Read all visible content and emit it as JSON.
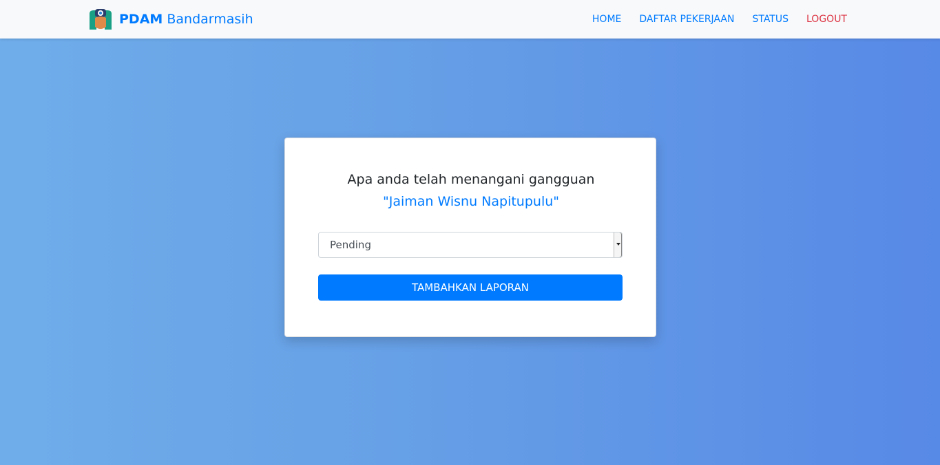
{
  "brand": {
    "bold": "PDAM",
    "rest": " Bandarmasih",
    "logo_icon": "pdam-logo-icon"
  },
  "nav": {
    "home": "HOME",
    "daftar": "DAFTAR PEKERJAAN",
    "status": "STATUS",
    "logout": "LOGOUT"
  },
  "card": {
    "question": "Apa anda telah menangani gangguan",
    "name": "\"Jaiman Wisnu Napitupulu\"",
    "status_select": {
      "selected": "Pending"
    },
    "submit_label": "TAMBAHKAN LAPORAN"
  },
  "colors": {
    "primary": "#007bff",
    "danger": "#dc3545",
    "navbar_bg": "#f8f9fa",
    "gradient_start": "#6fadea",
    "gradient_end": "#5789e6"
  }
}
